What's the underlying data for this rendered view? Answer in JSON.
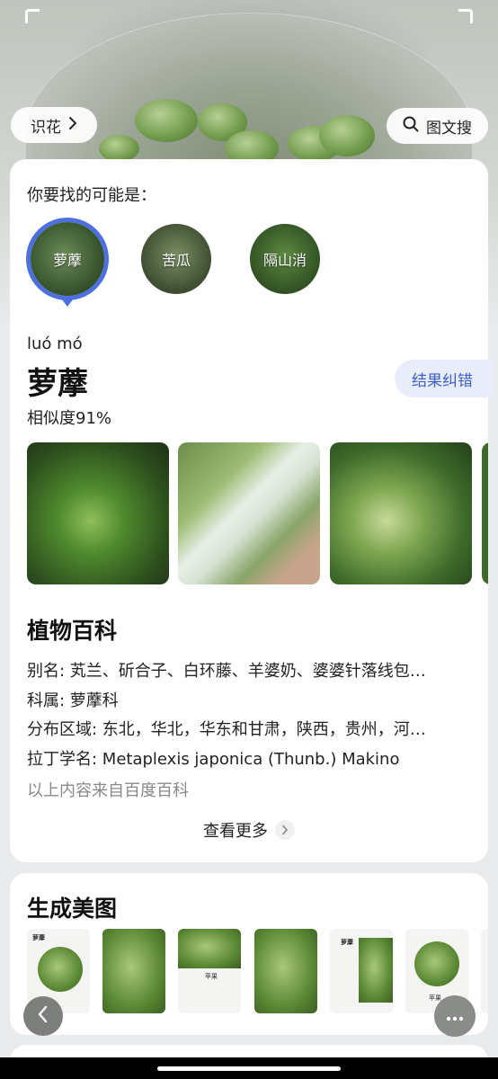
{
  "header": {
    "identify_label": "识花",
    "search_label": "图文搜"
  },
  "results": {
    "prompt": "你要找的可能是：",
    "candidates": [
      {
        "label": "萝藦",
        "selected": true
      },
      {
        "label": "苦瓜",
        "selected": false
      },
      {
        "label": "隔山消",
        "selected": false
      }
    ]
  },
  "plant": {
    "pinyin": "luó mó",
    "name": "萝藦",
    "similarity": "相似度91%",
    "correct_button": "结果纠错"
  },
  "encyclopedia": {
    "title": "植物百科",
    "alias": "别名: 芄兰、斫合子、白环藤、羊婆奶、婆婆针落线包…",
    "family": "科属: 萝藦科",
    "distribution": "分布区域: 东北，华北，华东和甘肃，陕西，贵州，河…",
    "latin": "拉丁学名: Metaplexis japonica (Thunb.) Makino",
    "source": "以上内容来自百度百科",
    "more": "查看更多"
  },
  "generate": {
    "title": "生成美图",
    "thumb1_label": "萝藦",
    "thumb3_label": "苹果",
    "thumb5_label": "萝藦",
    "thumb6_label": "苹果"
  },
  "colors": {
    "accent": "#4d6fe0",
    "correct_text": "#3d5fc7",
    "correct_bg": "#e8edf9"
  },
  "icons": {
    "identify_chevron": "chevron-right-icon",
    "search": "search-icon",
    "more_chevron": "chevron-right-icon",
    "back": "chevron-left-icon",
    "menu": "more-horizontal-icon"
  }
}
